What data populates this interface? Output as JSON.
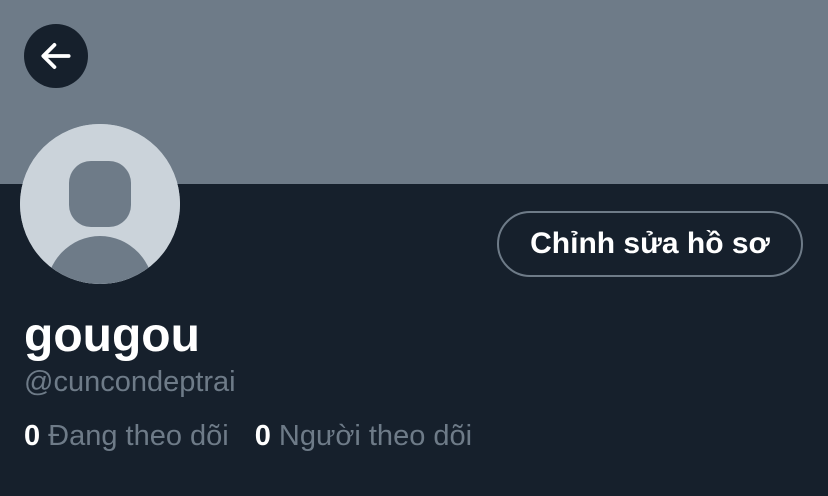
{
  "profile": {
    "display_name": "gougou",
    "handle": "@cuncondeptrai",
    "edit_button_label": "Chỉnh sửa hồ sơ",
    "following_count": "0",
    "following_label": "Đang theo dõi",
    "followers_count": "0",
    "followers_label": "Người theo dõi"
  },
  "icons": {
    "back": "back-arrow-icon",
    "avatar": "default-avatar-placeholder"
  },
  "colors": {
    "background": "#16202c",
    "banner": "#6e7b88",
    "avatar_bg": "#cbd3da",
    "text_primary": "#ffffff",
    "text_secondary": "#6e7b88"
  }
}
